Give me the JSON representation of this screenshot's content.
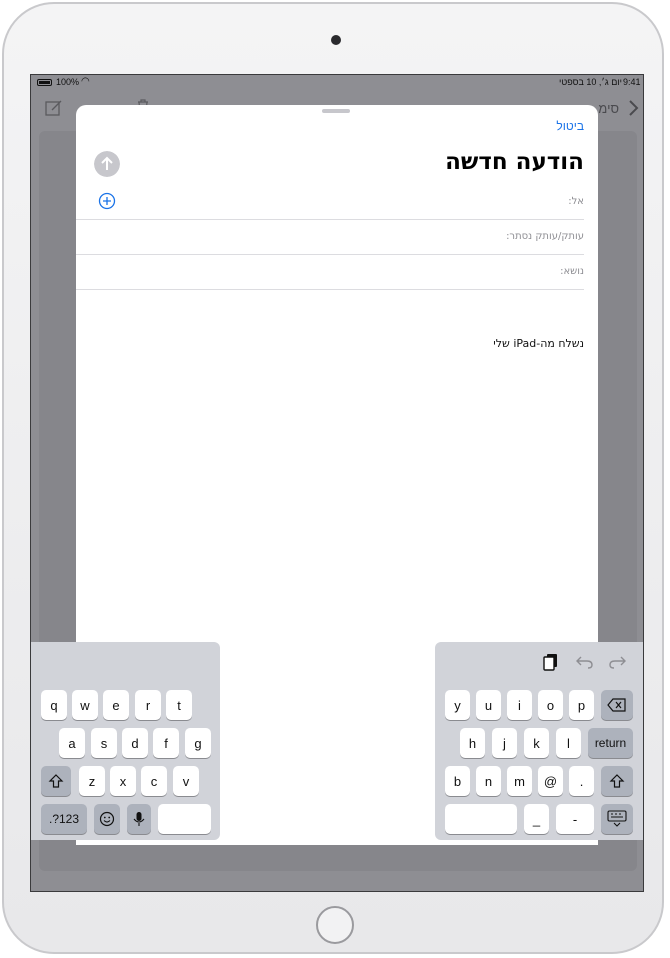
{
  "status_bar": {
    "battery": "100%",
    "date": "יום ג׳, 10 בספטי",
    "time": "9:41"
  },
  "background": {
    "back_label": "סימ"
  },
  "compose": {
    "cancel_label": "ביטול",
    "title": "הודעה חדשה",
    "to_label": "אל:",
    "cc_bcc_label": "עותק/עותק נסתר:",
    "subject_label": "נושא:",
    "signature": "נשלח מה-iPad שלי"
  },
  "keyboard": {
    "left": {
      "row1": [
        "q",
        "w",
        "e",
        "r",
        "t"
      ],
      "row2": [
        "a",
        "s",
        "d",
        "f",
        "g"
      ],
      "row3": [
        "z",
        "x",
        "c",
        "v"
      ],
      "numbers_label": ".?123"
    },
    "right": {
      "row1": [
        "y",
        "u",
        "i",
        "o",
        "p"
      ],
      "row2": [
        "h",
        "j",
        "k",
        "l"
      ],
      "return_label": "return",
      "row3": [
        "b",
        "n",
        "m",
        "@",
        "."
      ],
      "row4": [
        "_",
        "-"
      ]
    }
  },
  "icons": {
    "battery": "battery-icon",
    "wifi": "wifi-icon",
    "compose": "compose-icon",
    "trash": "trash-icon",
    "back": "chevron-right-icon",
    "send": "arrow-up-icon",
    "add_contact": "plus-circle-icon",
    "paste": "clipboard-icon",
    "undo": "undo-icon",
    "redo": "redo-icon",
    "delete": "backspace-icon",
    "shift": "shift-icon",
    "emoji": "emoji-icon",
    "dictation": "microphone-icon",
    "hide_keyboard": "keyboard-dismiss-icon"
  },
  "colors": {
    "accent": "#1a73e8",
    "keyboard_bg": "#d1d3d9",
    "dimmed_bg": "#8e8e93"
  }
}
